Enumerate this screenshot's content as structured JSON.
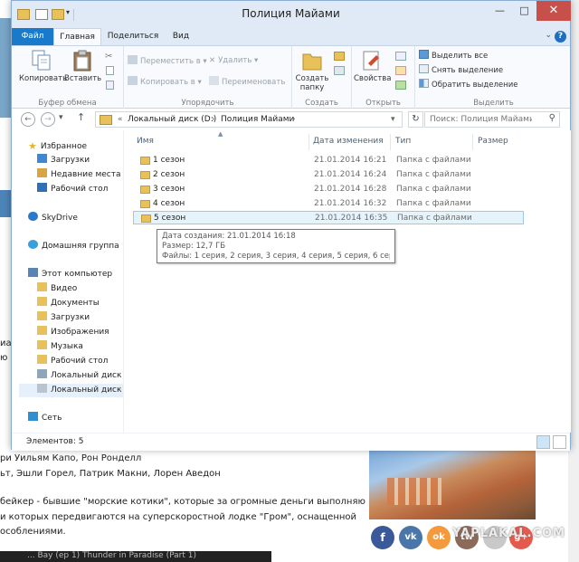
{
  "window": {
    "title": "Полиция Майами",
    "controls": {
      "minimize": "—",
      "maximize": "□",
      "close": "✕"
    }
  },
  "ribbon_tabs": [
    "Файл",
    "Главная",
    "Поделиться",
    "Вид"
  ],
  "ribbon": {
    "clipboard": {
      "label": "Буфер обмена",
      "copy": "Копировать",
      "paste": "Вставить"
    },
    "organize": {
      "label": "Упорядочить",
      "move_to": "Переместить в",
      "copy_to": "Копировать в",
      "delete": "Удалить",
      "rename": "Переименовать"
    },
    "create": {
      "label": "Создать",
      "new_folder_line1": "Создать",
      "new_folder_line2": "папку"
    },
    "open": {
      "label": "Открыть",
      "properties": "Свойства"
    },
    "select": {
      "label": "Выделить",
      "select_all": "Выделить все",
      "select_none": "Снять выделение",
      "invert": "Обратить выделение"
    }
  },
  "address": {
    "prefix": "«",
    "crumbs": [
      "Локальный диск (D:)",
      "Полиция Майами"
    ],
    "separator": "›",
    "search_placeholder": "Поиск: Полиция Майами"
  },
  "nav_pane": {
    "favorites": "Избранное",
    "favorites_items": [
      "Загрузки",
      "Недавние места",
      "Рабочий стол"
    ],
    "skydrive": "SkyDrive",
    "homegroup": "Домашняя группа",
    "computer": "Этот компьютер",
    "computer_items": [
      "Видео",
      "Документы",
      "Загрузки",
      "Изображения",
      "Музыка",
      "Рабочий стол",
      "Локальный диск (C",
      "Локальный диск (D"
    ],
    "network": "Сеть"
  },
  "columns": {
    "name": "Имя",
    "date": "Дата изменения",
    "type": "Тип",
    "size": "Размер"
  },
  "files": [
    {
      "name": "1 сезон",
      "date": "21.01.2014 16:21",
      "type": "Папка с файлами"
    },
    {
      "name": "2 сезон",
      "date": "21.01.2014 16:24",
      "type": "Папка с файлами"
    },
    {
      "name": "3 сезон",
      "date": "21.01.2014 16:28",
      "type": "Папка с файлами"
    },
    {
      "name": "4 сезон",
      "date": "21.01.2014 16:32",
      "type": "Папка с файлами"
    },
    {
      "name": "5 сезон",
      "date": "21.01.2014 16:35",
      "type": "Папка с файлами"
    }
  ],
  "tooltip": {
    "created": "Дата создания: 21.01.2014 16:18",
    "size": "Размер: 12,7 ГБ",
    "files": "Файлы: 1 серия, 2 серия, 3 серия, 4 серия, 5 серия, 6 серия, ..."
  },
  "status": {
    "items": "Элементов: 5"
  },
  "background_page": {
    "line1": "ри Уильям Капо, Рон Ронделл",
    "line2": "ьт, Эшли Горел, Патрик Макни, Лорен Аведон",
    "line3": "бейкер - бывшие \"морские котики\", которые за огромные деньги выполняют",
    "line4": "и которых передвигаются на суперскоростной лодке \"Гром\", оснащенной",
    "line5": "особлениями.",
    "left_word1": "иа",
    "left_word2": "ю",
    "video_title": "... Bay (ep 1) Thunder in Paradise (Part 1)",
    "watermark": "YAPLAKAL.COM",
    "social": [
      "f",
      "vk",
      "ok",
      "tw",
      "g+"
    ]
  }
}
